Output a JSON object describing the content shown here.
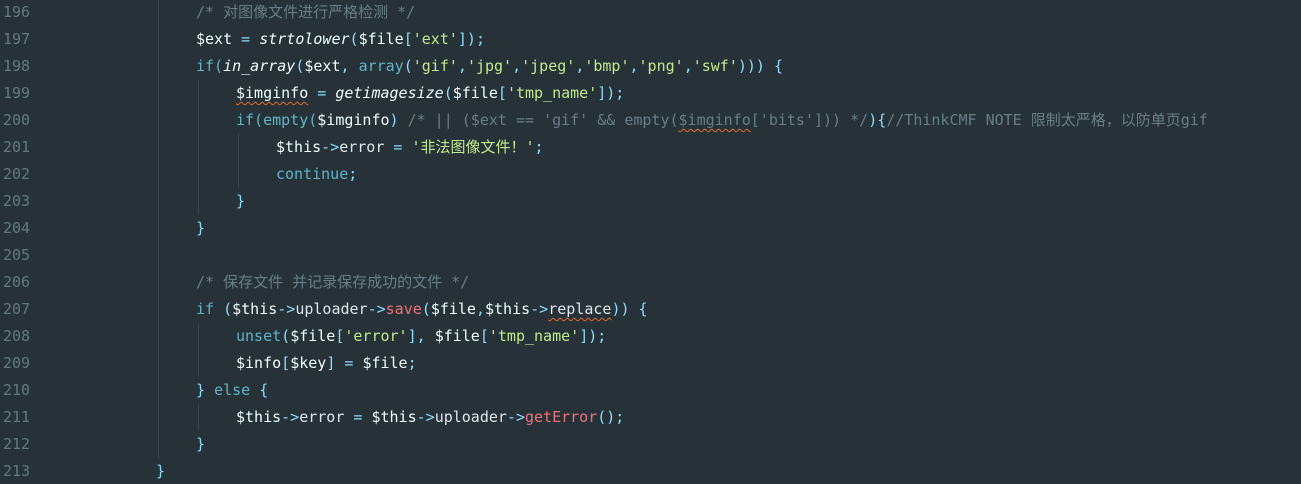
{
  "editor": {
    "line_numbers": [
      "196",
      "197",
      "198",
      "199",
      "200",
      "201",
      "202",
      "203",
      "204",
      "205",
      "206",
      "207",
      "208",
      "209",
      "210",
      "211",
      "212",
      "213"
    ],
    "lines": [
      {
        "indent": 1,
        "tokens": [
          {
            "t": "cmt",
            "v": "/* 对图像文件进行严格检测 */"
          }
        ]
      },
      {
        "indent": 1,
        "tokens": [
          {
            "t": "var",
            "v": "$ext"
          },
          {
            "t": "op",
            "v": " = "
          },
          {
            "t": "fn",
            "v": "strtolower"
          },
          {
            "t": "punc",
            "v": "("
          },
          {
            "t": "var",
            "v": "$file"
          },
          {
            "t": "punc",
            "v": "["
          },
          {
            "t": "str",
            "v": "'ext'"
          },
          {
            "t": "punc",
            "v": "]);"
          }
        ]
      },
      {
        "indent": 1,
        "tokens": [
          {
            "t": "kw",
            "v": "if("
          },
          {
            "t": "fn",
            "v": "in_array"
          },
          {
            "t": "punc",
            "v": "("
          },
          {
            "t": "var",
            "v": "$ext"
          },
          {
            "t": "punc",
            "v": ", "
          },
          {
            "t": "kw",
            "v": "array"
          },
          {
            "t": "punc",
            "v": "("
          },
          {
            "t": "str",
            "v": "'gif'"
          },
          {
            "t": "punc",
            "v": ","
          },
          {
            "t": "str",
            "v": "'jpg'"
          },
          {
            "t": "punc",
            "v": ","
          },
          {
            "t": "str",
            "v": "'jpeg'"
          },
          {
            "t": "punc",
            "v": ","
          },
          {
            "t": "str",
            "v": "'bmp'"
          },
          {
            "t": "punc",
            "v": ","
          },
          {
            "t": "str",
            "v": "'png'"
          },
          {
            "t": "punc",
            "v": ","
          },
          {
            "t": "str",
            "v": "'swf'"
          },
          {
            "t": "punc",
            "v": "))) {"
          }
        ]
      },
      {
        "indent": 2,
        "tokens": [
          {
            "t": "var",
            "v": "$imginfo",
            "sq": true
          },
          {
            "t": "op",
            "v": " = "
          },
          {
            "t": "fn",
            "v": "getimagesize"
          },
          {
            "t": "punc",
            "v": "("
          },
          {
            "t": "var",
            "v": "$file"
          },
          {
            "t": "punc",
            "v": "["
          },
          {
            "t": "str",
            "v": "'tmp_name'"
          },
          {
            "t": "punc",
            "v": "]);"
          }
        ]
      },
      {
        "indent": 2,
        "tokens": [
          {
            "t": "kw",
            "v": "if(empty("
          },
          {
            "t": "var",
            "v": "$imginfo"
          },
          {
            "t": "punc",
            "v": ")"
          },
          {
            "t": "cmt",
            "v": " /* || ($ext == 'gif' && empty("
          },
          {
            "t": "cmt",
            "v": "$imginfo",
            "sq": true
          },
          {
            "t": "cmt",
            "v": "['bits'])) */"
          },
          {
            "t": "punc",
            "v": "){"
          },
          {
            "t": "cmt",
            "v": "//ThinkCMF NOTE 限制太严格，以防单页gif"
          }
        ]
      },
      {
        "indent": 3,
        "tokens": [
          {
            "t": "var",
            "v": "$this"
          },
          {
            "t": "op",
            "v": "->"
          },
          {
            "t": "prop",
            "v": "error"
          },
          {
            "t": "op",
            "v": " = "
          },
          {
            "t": "str",
            "v": "'非法图像文件！'"
          },
          {
            "t": "punc",
            "v": ";"
          }
        ]
      },
      {
        "indent": 3,
        "tokens": [
          {
            "t": "kw",
            "v": "continue"
          },
          {
            "t": "punc",
            "v": ";"
          }
        ]
      },
      {
        "indent": 2,
        "tokens": [
          {
            "t": "punc",
            "v": "}"
          }
        ]
      },
      {
        "indent": 1,
        "tokens": [
          {
            "t": "punc",
            "v": "}"
          }
        ]
      },
      {
        "indent": 1,
        "tokens": []
      },
      {
        "indent": 1,
        "tokens": [
          {
            "t": "cmt",
            "v": "/* 保存文件 并记录保存成功的文件 */"
          }
        ]
      },
      {
        "indent": 1,
        "tokens": [
          {
            "t": "kw",
            "v": "if "
          },
          {
            "t": "punc",
            "v": "("
          },
          {
            "t": "var",
            "v": "$this"
          },
          {
            "t": "op",
            "v": "->"
          },
          {
            "t": "prop",
            "v": "uploader"
          },
          {
            "t": "op",
            "v": "->"
          },
          {
            "t": "method",
            "v": "save"
          },
          {
            "t": "punc",
            "v": "("
          },
          {
            "t": "var",
            "v": "$file"
          },
          {
            "t": "punc",
            "v": ","
          },
          {
            "t": "var",
            "v": "$this"
          },
          {
            "t": "op",
            "v": "->"
          },
          {
            "t": "prop",
            "v": "replace",
            "sq": true
          },
          {
            "t": "punc",
            "v": ")) {"
          }
        ]
      },
      {
        "indent": 2,
        "tokens": [
          {
            "t": "kw",
            "v": "unset"
          },
          {
            "t": "punc",
            "v": "("
          },
          {
            "t": "var",
            "v": "$file"
          },
          {
            "t": "punc",
            "v": "["
          },
          {
            "t": "str",
            "v": "'error'"
          },
          {
            "t": "punc",
            "v": "], "
          },
          {
            "t": "var",
            "v": "$file"
          },
          {
            "t": "punc",
            "v": "["
          },
          {
            "t": "str",
            "v": "'tmp_name'"
          },
          {
            "t": "punc",
            "v": "]);"
          }
        ]
      },
      {
        "indent": 2,
        "tokens": [
          {
            "t": "var",
            "v": "$info"
          },
          {
            "t": "punc",
            "v": "["
          },
          {
            "t": "var",
            "v": "$key"
          },
          {
            "t": "punc",
            "v": "]"
          },
          {
            "t": "op",
            "v": " = "
          },
          {
            "t": "var",
            "v": "$file"
          },
          {
            "t": "punc",
            "v": ";"
          }
        ]
      },
      {
        "indent": 1,
        "tokens": [
          {
            "t": "punc",
            "v": "} "
          },
          {
            "t": "kw",
            "v": "else"
          },
          {
            "t": "punc",
            "v": " {"
          }
        ]
      },
      {
        "indent": 2,
        "tokens": [
          {
            "t": "var",
            "v": "$this"
          },
          {
            "t": "op",
            "v": "->"
          },
          {
            "t": "prop",
            "v": "error"
          },
          {
            "t": "op",
            "v": " = "
          },
          {
            "t": "var",
            "v": "$this"
          },
          {
            "t": "op",
            "v": "->"
          },
          {
            "t": "prop",
            "v": "uploader"
          },
          {
            "t": "op",
            "v": "->"
          },
          {
            "t": "method",
            "v": "getError"
          },
          {
            "t": "punc",
            "v": "();"
          }
        ]
      },
      {
        "indent": 1,
        "tokens": [
          {
            "t": "punc",
            "v": "}"
          }
        ]
      },
      {
        "indent": 0,
        "tokens": [
          {
            "t": "punc",
            "v": "}"
          }
        ]
      }
    ]
  },
  "colors": {
    "background": "#263238",
    "gutter_text": "#647882",
    "indent_guide": "#37474f",
    "comment": "#697d87",
    "string": "#c3e88d",
    "keyword": "#5fb4c8",
    "method": "#f07178"
  }
}
